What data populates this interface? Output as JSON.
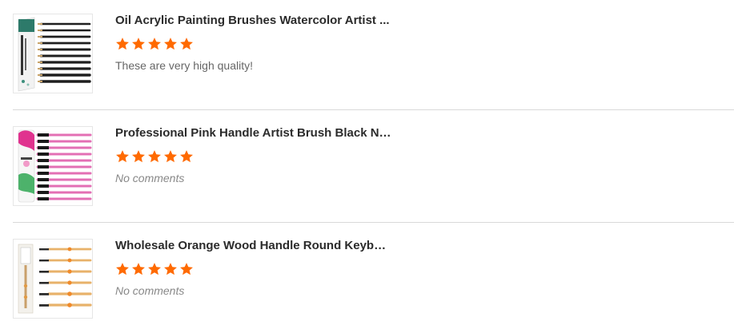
{
  "colors": {
    "star": "#ff6a00",
    "divider": "#d9d9d9",
    "title": "#2b2b2b",
    "comment": "#666666"
  },
  "reviews": [
    {
      "title": "Oil Acrylic Painting Brushes Watercolor Artist ...",
      "rating": 5,
      "comment": "These are very high quality!",
      "thumb_icon": "black-brush-set-box-image"
    },
    {
      "title": "Professional Pink Handle Artist Brush Black Ny...",
      "rating": 5,
      "comment": "No comments",
      "thumb_icon": "pink-brush-set-image"
    },
    {
      "title": "Wholesale Orange Wood Handle Round Keyboa...",
      "rating": 5,
      "comment": "No comments",
      "thumb_icon": "wood-brush-set-image"
    }
  ]
}
